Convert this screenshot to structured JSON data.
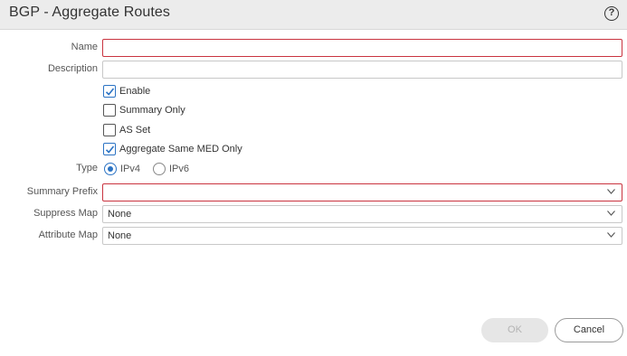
{
  "dialog": {
    "title": "BGP - Aggregate Routes",
    "help_glyph": "?"
  },
  "form": {
    "name": {
      "label": "Name",
      "value": ""
    },
    "description": {
      "label": "Description",
      "value": ""
    },
    "checkboxes": [
      {
        "label": "Enable",
        "checked": true
      },
      {
        "label": "Summary Only",
        "checked": false
      },
      {
        "label": "AS Set",
        "checked": false
      },
      {
        "label": "Aggregate Same MED Only",
        "checked": true
      }
    ],
    "type": {
      "label": "Type",
      "options": [
        {
          "label": "IPv4",
          "selected": true
        },
        {
          "label": "IPv6",
          "selected": false
        }
      ]
    },
    "summary_prefix": {
      "label": "Summary Prefix",
      "value": ""
    },
    "suppress_map": {
      "label": "Suppress Map",
      "value": "None"
    },
    "attribute_map": {
      "label": "Attribute Map",
      "value": "None"
    }
  },
  "buttons": {
    "ok_label": "OK",
    "cancel_label": "Cancel"
  },
  "colors": {
    "accent": "#2b73c4",
    "error_border": "#c9333f"
  }
}
